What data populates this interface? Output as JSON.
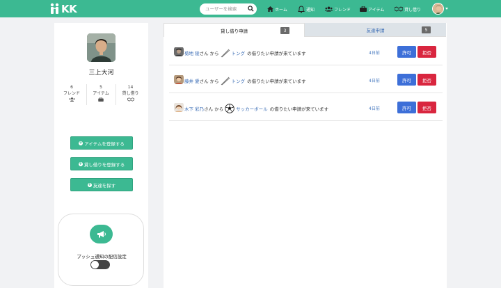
{
  "brand": {
    "logo_text": "KK",
    "accent": "#3cb992"
  },
  "search": {
    "placeholder": "ユーザーを検索"
  },
  "nav": {
    "items": [
      {
        "label": "ホーム",
        "icon": "home-icon"
      },
      {
        "label": "通知",
        "icon": "bell-icon"
      },
      {
        "label": "フレンド",
        "icon": "users-icon"
      },
      {
        "label": "アイテム",
        "icon": "briefcase-icon"
      },
      {
        "label": "貸し借り",
        "icon": "handshake-icon"
      }
    ]
  },
  "profile": {
    "name": "三上大河",
    "stats": [
      {
        "count": "6",
        "label": "フレンド",
        "icon": "users-icon"
      },
      {
        "count": "5",
        "label": "アイテム",
        "icon": "briefcase-icon"
      },
      {
        "count": "14",
        "label": "貸し借り",
        "icon": "handshake-icon"
      }
    ],
    "buttons": {
      "register_item": "アイテムを登録する",
      "register_lend": "貸し借りを登録する",
      "find_friends": "友達を探す"
    },
    "push": {
      "label": "プッシュ通知の配信設定",
      "enabled": false
    }
  },
  "tabs": [
    {
      "label": "貸し借り申請",
      "count": "3",
      "active": true
    },
    {
      "label": "友達申請",
      "count": "5",
      "active": false
    }
  ],
  "requests": [
    {
      "user": "菊地 陵",
      "san": "さん から",
      "item": "トング",
      "item_icon": "tongs-icon",
      "message": "の借りたい申請が来ています",
      "time": "4日前",
      "approve": "許可",
      "reject": "拒否"
    },
    {
      "user": "藤井 愛",
      "san": "さん から",
      "item": "トング",
      "item_icon": "tongs-icon",
      "message": "の借りたい申請が来ています",
      "time": "4日前",
      "approve": "許可",
      "reject": "拒否"
    },
    {
      "user": "木下 彩乃",
      "san": "さん から",
      "item": "サッカーボール",
      "item_icon": "soccer-ball-icon",
      "message": "の借りたい申請が来ています",
      "time": "4日前",
      "approve": "許可",
      "reject": "拒否"
    }
  ]
}
